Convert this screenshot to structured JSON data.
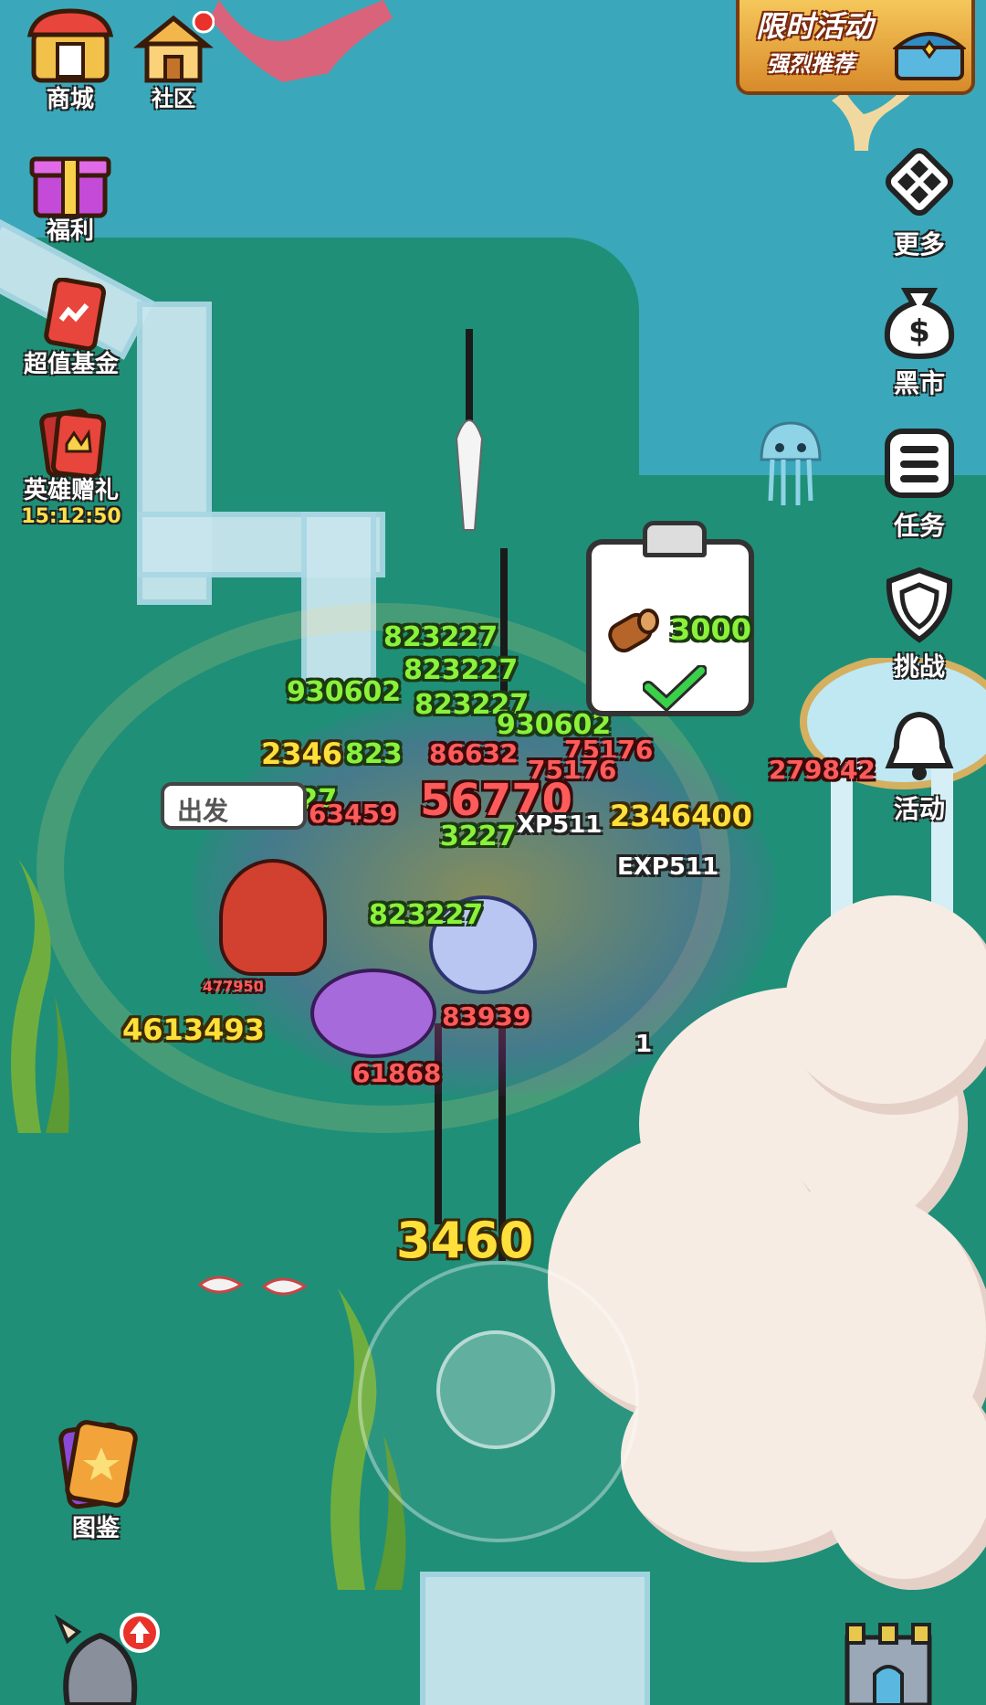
{
  "top_left_menu": [
    {
      "label": "商城",
      "icon": "shop-icon",
      "color": "#e8453c"
    },
    {
      "label": "社区",
      "icon": "community-house-icon",
      "color": "#f2b64a"
    }
  ],
  "left_menu": [
    {
      "label": "福利",
      "icon": "gift-icon",
      "color": "#c44ad8"
    },
    {
      "label": "超值基金",
      "icon": "fund-card-icon",
      "color": "#e8453c"
    },
    {
      "label": "英雄赠礼",
      "icon": "hero-gift-icon",
      "color": "#e8453c",
      "timer": "15:12:50"
    }
  ],
  "bottom_left_menu": [
    {
      "label": "图鉴",
      "icon": "collection-card-icon",
      "color": "#f2b64a"
    }
  ],
  "event_banner": {
    "title": "限时活动",
    "subtitle": "强烈推荐"
  },
  "right_menu": [
    {
      "label": "更多",
      "icon": "more-grid-icon"
    },
    {
      "label": "黑市",
      "icon": "money-bag-icon"
    },
    {
      "label": "任务",
      "icon": "task-list-icon"
    },
    {
      "label": "挑战",
      "icon": "shield-icon"
    },
    {
      "label": "活动",
      "icon": "bell-icon"
    }
  ],
  "quest": {
    "count": "3000",
    "icon": "wood-log-icon",
    "status": "check-icon"
  },
  "chat_bubble": {
    "text": "出发"
  },
  "damage_numbers": [
    {
      "text": "823227",
      "color": "green"
    },
    {
      "text": "823227",
      "color": "green"
    },
    {
      "text": "930602",
      "color": "green"
    },
    {
      "text": "823227",
      "color": "green"
    },
    {
      "text": "930602",
      "color": "green"
    },
    {
      "text": "2346",
      "color": "yellow"
    },
    {
      "text": "823",
      "color": "green"
    },
    {
      "text": "86632",
      "color": "red"
    },
    {
      "text": "75176",
      "color": "red"
    },
    {
      "text": "75176",
      "color": "red"
    },
    {
      "text": "279842",
      "color": "red"
    },
    {
      "text": "823227",
      "color": "green"
    },
    {
      "text": "63459",
      "color": "red"
    },
    {
      "text": "56770",
      "color": "red"
    },
    {
      "text": "3227",
      "color": "green"
    },
    {
      "text": "XP511",
      "color": "white"
    },
    {
      "text": "2346400",
      "color": "yellow"
    },
    {
      "text": "EXP511",
      "color": "white"
    },
    {
      "text": "823227",
      "color": "green"
    },
    {
      "text": "477950",
      "color": "red"
    },
    {
      "text": "83939",
      "color": "red"
    },
    {
      "text": "4613493",
      "color": "yellow"
    },
    {
      "text": "1",
      "color": "white"
    },
    {
      "text": "61868",
      "color": "red"
    },
    {
      "text": "3460",
      "color": "yellow"
    }
  ]
}
